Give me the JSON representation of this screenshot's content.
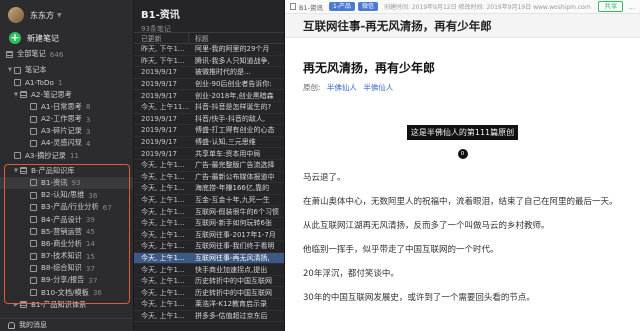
{
  "sidebar": {
    "user_name": "东东方",
    "new_note_label": "新建笔记",
    "all_notes": {
      "label": "全部笔记",
      "count": "646"
    },
    "notebook_root": "笔记本",
    "items": [
      {
        "label": "A1-ToDo",
        "count": "1"
      },
      {
        "label": "A2-笔记思考",
        "count": ""
      },
      {
        "label": "A1-日常思考",
        "count": "8"
      },
      {
        "label": "A2-工作思考",
        "count": "3"
      },
      {
        "label": "A3-碎片记录",
        "count": "3"
      },
      {
        "label": "A4-灵感闪现",
        "count": "4"
      },
      {
        "label": "A3-摘抄记录",
        "count": "11"
      },
      {
        "label": "B-产品知识库",
        "count": ""
      },
      {
        "label": "B1-资讯",
        "count": "93"
      },
      {
        "label": "B2-认知/思维",
        "count": "36"
      },
      {
        "label": "B3-产品/行业分析",
        "count": "67"
      },
      {
        "label": "B4-产品设计",
        "count": "39"
      },
      {
        "label": "B5-营销运营",
        "count": "45"
      },
      {
        "label": "B6-商业分析",
        "count": "14"
      },
      {
        "label": "B7-技术知识",
        "count": "15"
      },
      {
        "label": "B8-综合知识",
        "count": "37"
      },
      {
        "label": "B9-分享/报告",
        "count": "37"
      },
      {
        "label": "B10-文档/模板",
        "count": "36"
      },
      {
        "label": "B1-产品知识体系",
        "count": ""
      }
    ],
    "bottom_label": "我的消息"
  },
  "notelist": {
    "title": "B1-资讯",
    "subtitle": "93条笔记",
    "col_date": "已更新",
    "col_title": "标题",
    "rows": [
      {
        "date": "昨天, 下午1...",
        "title": "阿里-我的阿里的29个月"
      },
      {
        "date": "昨天, 下午1...",
        "title": "腾讯-我多人只知道战争,"
      },
      {
        "date": "2019/9/17",
        "title": "被微推时代的是..."
      },
      {
        "date": "2019/9/17",
        "title": "创业-90后创业者告诉你:"
      },
      {
        "date": "2019/9/17",
        "title": "创业-2018年,创业黑暗森"
      },
      {
        "date": "今天, 上午11...",
        "title": "抖音-抖音是怎样诞生的?"
      },
      {
        "date": "2019/9/17",
        "title": "抖音/快手-抖音的敌人,"
      },
      {
        "date": "2019/9/17",
        "title": "傅盛-打工得有创业的心态"
      },
      {
        "date": "2019/9/17",
        "title": "傅盛-认知,三元思维"
      },
      {
        "date": "2019/9/17",
        "title": "共享单车:资本用中局"
      },
      {
        "date": "今天, 上午1...",
        "title": "广告-最完整版广告流选择"
      },
      {
        "date": "今天, 上午1...",
        "title": "广告-最新公布媒体报道中"
      },
      {
        "date": "今天, 上午1...",
        "title": "海底捞-年赚166亿,靠的"
      },
      {
        "date": "今天, 上午1...",
        "title": "互金-互金十年,九死一生"
      },
      {
        "date": "今天, 上午1...",
        "title": "互联网-假装很牛的6个习惯"
      },
      {
        "date": "今天, 上午1...",
        "title": "互联网-新手如何玩转6张"
      },
      {
        "date": "今天, 上午1...",
        "title": "互联网往事-2017年1-7月"
      },
      {
        "date": "今天, 上午1...",
        "title": "互联网往事-我们终于看明"
      },
      {
        "date": "今天, 上午1...",
        "title": "互联网往事-再无风清扬,"
      },
      {
        "date": "今天, 上午1...",
        "title": "快手商业加速拐点,提出"
      },
      {
        "date": "今天, 上午1...",
        "title": "历史转折中的中国互联网"
      },
      {
        "date": "今天, 上午1...",
        "title": "历史转折中的中国互联网"
      },
      {
        "date": "今天, 上午1...",
        "title": "莱浩洋-K12教育启示录"
      },
      {
        "date": "今天, 上午1...",
        "title": "拼多多-估值超过京东后"
      }
    ],
    "selected_index": 18
  },
  "noteview": {
    "toolbar": {
      "notebook": "B1-资讯",
      "tag1": "1-产品",
      "tag2": "微信",
      "meta": "创建时间: 2019年9月12日  修改时间: 2019年9月19日  www.woshipm.com",
      "share_label": "共享",
      "more": "..."
    },
    "title": "互联网往事-再无风清扬，再有少年郎",
    "heading": "再无风清扬，再有少年郎",
    "author_label": "原创:",
    "author_1": "半佛仙人",
    "author_2": "半佛仙人",
    "dark_label": "这是半佛仙人的第111篇原创",
    "circle_badge": "0",
    "paragraphs": [
      "马云退了。",
      "在萧山奥体中心，无数阿里人的祝福中，流着眼泪，结束了自己在阿里的最后一天。",
      "从此互联网江湖再无风清扬，反而多了一个叫做马云的乡村教师。",
      "他临别一挥手，似乎带走了中国互联网的一个时代。",
      "20年浮沉，都付笑谈中。",
      "30年的中国互联网发展史，或许到了一个需要回头看的节点。"
    ]
  },
  "colors": {
    "accent_green": "#2dbe60",
    "selection_blue": "#3d5a86",
    "highlight_border": "#e05a3a"
  }
}
